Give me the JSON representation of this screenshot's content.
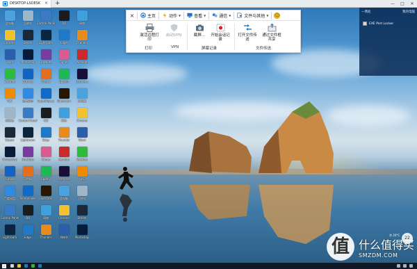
{
  "window": {
    "tab_title": "DESKTOP-LSDESK",
    "tab_close": "×",
    "new_tab": "+",
    "win_min": "—",
    "win_max": "□",
    "win_close": "✕"
  },
  "toolbar": {
    "close": "×",
    "tabs": [
      {
        "label": "主页",
        "icon": "home-icon"
      },
      {
        "label": "动作",
        "icon": "lightning-icon",
        "dropdown": true
      },
      {
        "label": "查看",
        "icon": "monitor-icon",
        "dropdown": true
      },
      {
        "label": "通信",
        "icon": "chat-icon",
        "dropdown": true
      },
      {
        "label": "文件与其他",
        "icon": "file-icon",
        "dropdown": true
      }
    ],
    "smiley": "☺",
    "ribbon": {
      "remote_print": "激活远程打印",
      "start_vpn": "启动VPN",
      "screenshot": "截屏...",
      "start_recording": "开始会话记录",
      "open_file_transfer": "打开文件传送",
      "share_via_file_box": "通过文件框共享",
      "group_print": "打印",
      "group_vpn": "VPN",
      "group_record": "屏幕记录",
      "group_file": "文件传送"
    }
  },
  "desktop_icons": [
    {
      "label": "此电脑",
      "color": "#4aa3df"
    },
    {
      "label": "回收站",
      "color": "#9fb6c9"
    },
    {
      "label": "Control Panel",
      "color": "#3b7ac6"
    },
    {
      "label": "QQ",
      "color": "#1c1c1c"
    },
    {
      "label": "网络",
      "color": "#3ea0dc"
    },
    {
      "label": "Chrome",
      "color": "#f2c12e"
    },
    {
      "label": "Steam",
      "color": "#1b2838"
    },
    {
      "label": "Lightroom",
      "color": "#0a2540"
    },
    {
      "label": "Edge",
      "color": "#1e7ac8"
    },
    {
      "label": "Thunder",
      "color": "#e88b1c"
    },
    {
      "label": "Word",
      "color": "#2b5fab"
    },
    {
      "label": "Photoshop",
      "color": "#061c3a"
    },
    {
      "label": "OneNote",
      "color": "#7b3aa0"
    },
    {
      "label": "iTunes",
      "color": "#d85c8f"
    },
    {
      "label": "Acrobat",
      "color": "#cc2a2a"
    },
    {
      "label": "WeChat",
      "color": "#2dbb3a"
    },
    {
      "label": "Outlook",
      "color": "#1164c4"
    },
    {
      "label": "Firefox",
      "color": "#e46e1b"
    },
    {
      "label": "Spotify",
      "color": "#1db954"
    },
    {
      "label": "Premiere",
      "color": "#1a0f3a"
    },
    {
      "label": "VLC",
      "color": "#f08a00"
    },
    {
      "label": "百度网盘",
      "color": "#2f8ae6"
    },
    {
      "label": "TeamViewer",
      "color": "#0e6bc9"
    },
    {
      "label": "Illustrator",
      "color": "#2b1700"
    }
  ],
  "side_panel": {
    "title_left": "一两处",
    "title_right": "我的电脑",
    "item": "EXE Port Locker"
  },
  "watermark": {
    "logo": "值",
    "name": "什么值得买",
    "url": "SMZDM.COM"
  },
  "clock": {
    "value": "22",
    "hint": "冷 20°C"
  }
}
